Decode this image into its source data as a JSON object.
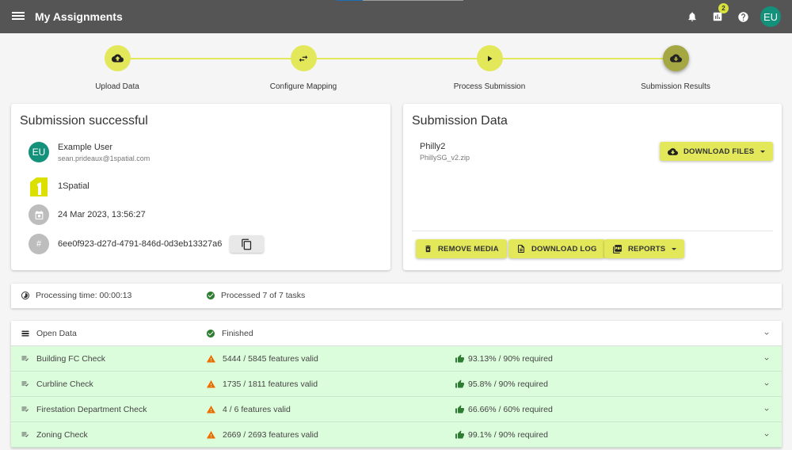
{
  "header": {
    "title": "My Assignments",
    "notifications_badge": "2",
    "avatar_initials": "EU",
    "icons": [
      "menu-icon",
      "bell-icon",
      "chart-icon",
      "help-icon"
    ]
  },
  "colors": {
    "appbar": "#555555",
    "accent": "#e3e85a",
    "accent_active": "#a5a842",
    "avatar": "#14917a",
    "success": "#2e7d32",
    "warning": "#ef6c00",
    "row_ok": "#dcfddc"
  },
  "stepper": {
    "steps": [
      {
        "label": "Upload Data",
        "icon": "cloud-upload-icon"
      },
      {
        "label": "Configure Mapping",
        "icon": "swap-icon"
      },
      {
        "label": "Process Submission",
        "icon": "play-icon"
      },
      {
        "label": "Submission Results",
        "icon": "cloud-download-icon",
        "active": true
      }
    ]
  },
  "submission": {
    "title": "Submission successful",
    "user_name": "Example User",
    "user_email": "sean.prideaux@1spatial.com",
    "user_initials": "EU",
    "organisation": "1Spatial",
    "timestamp": "24 Mar 2023, 13:56:27",
    "id": "6ee0f923-d27d-4791-846d-0d3eb13327a6",
    "hash_symbol": "#"
  },
  "submission_data": {
    "title": "Submission Data",
    "name": "Philly2",
    "file": "PhillySG_v2.zip",
    "download_files_label": "DOWNLOAD FILES",
    "remove_media_label": "REMOVE MEDIA",
    "download_log_label": "DOWNLOAD LOG",
    "reports_label": "REPORTS"
  },
  "status": {
    "processing_time": "Processing time: 00:00:13",
    "processed": "Processed 7 of 7 tasks"
  },
  "tasks": [
    {
      "name": "Open Data",
      "status": "Finished",
      "result": ""
    },
    {
      "name": "Building FC Check",
      "status": "5444 / 5845 features valid",
      "result": "93.13% / 90% required"
    },
    {
      "name": "Curbline Check",
      "status": "1735 / 1811 features valid",
      "result": "95.8% / 90% required"
    },
    {
      "name": "Firestation Department Check",
      "status": "4 / 6 features valid",
      "result": "66.66% / 60% required"
    },
    {
      "name": "Zoning Check",
      "status": "2669 / 2693 features valid",
      "result": "99.1% / 90% required"
    }
  ]
}
